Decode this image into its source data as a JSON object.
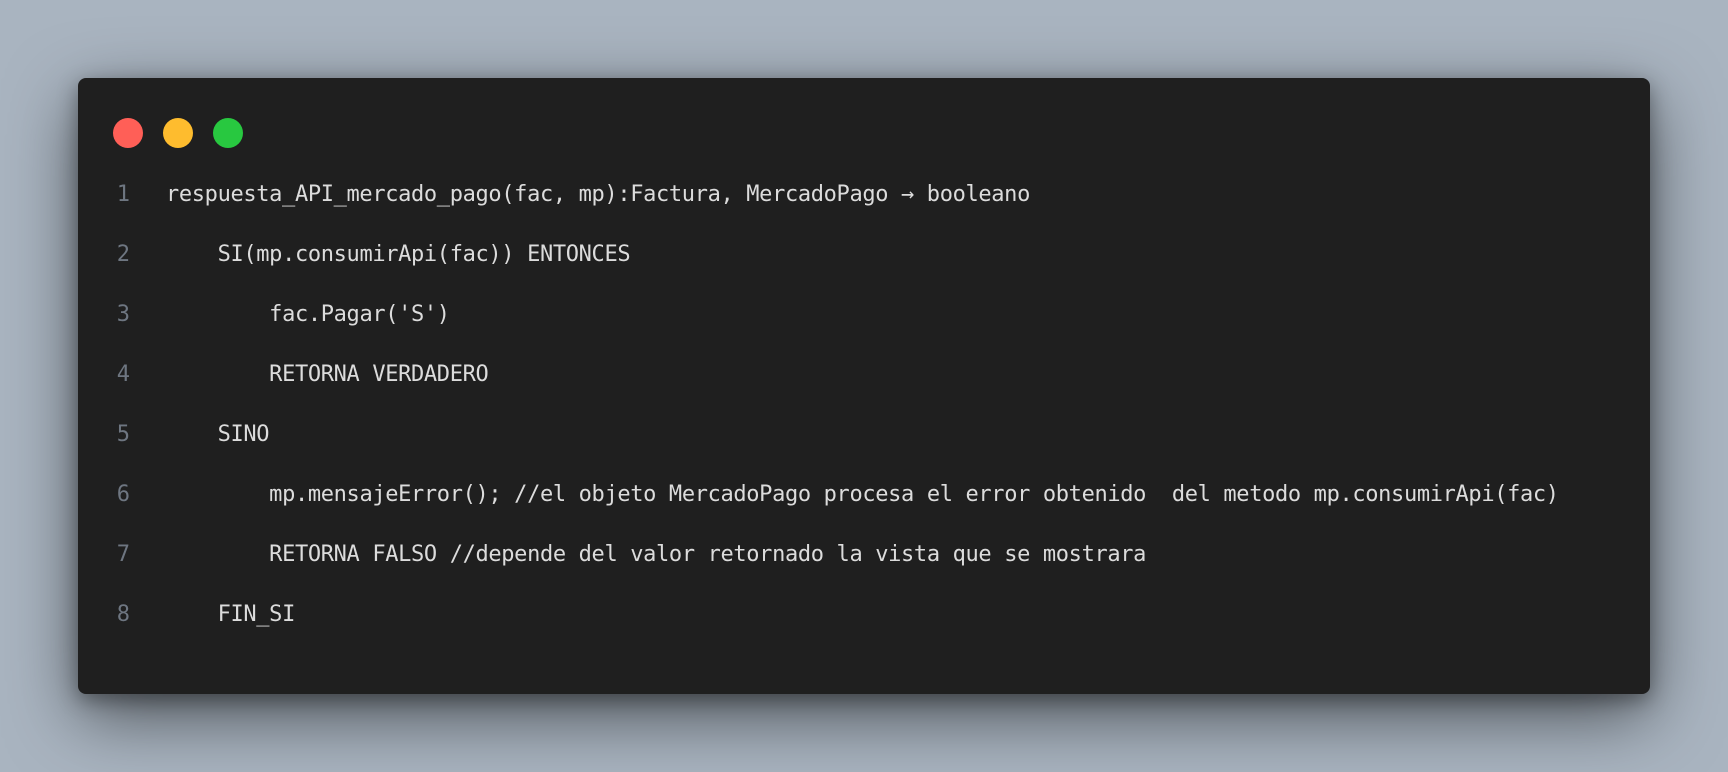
{
  "colors": {
    "background": "#a9b4c0",
    "window": "#1f1f1f",
    "close": "#ff5f57",
    "minimize": "#febc2e",
    "maximize": "#28c840",
    "code_text": "#dcdcdc",
    "line_number": "#6e7681"
  },
  "window_controls": {
    "close": "close-icon",
    "minimize": "minimize-icon",
    "maximize": "maximize-icon"
  },
  "code": {
    "lines": [
      {
        "number": "1",
        "text": "respuesta_API_mercado_pago(fac, mp):Factura, MercadoPago → booleano"
      },
      {
        "number": "2",
        "text": "    SI(mp.consumirApi(fac)) ENTONCES"
      },
      {
        "number": "3",
        "text": "        fac.Pagar('S')"
      },
      {
        "number": "4",
        "text": "        RETORNA VERDADERO"
      },
      {
        "number": "5",
        "text": "    SINO"
      },
      {
        "number": "6",
        "text": "        mp.mensajeError(); //el objeto MercadoPago procesa el error obtenido  del metodo mp.consumirApi(fac)"
      },
      {
        "number": "7",
        "text": "        RETORNA FALSO //depende del valor retornado la vista que se mostrara"
      },
      {
        "number": "8",
        "text": "    FIN_SI"
      }
    ]
  }
}
